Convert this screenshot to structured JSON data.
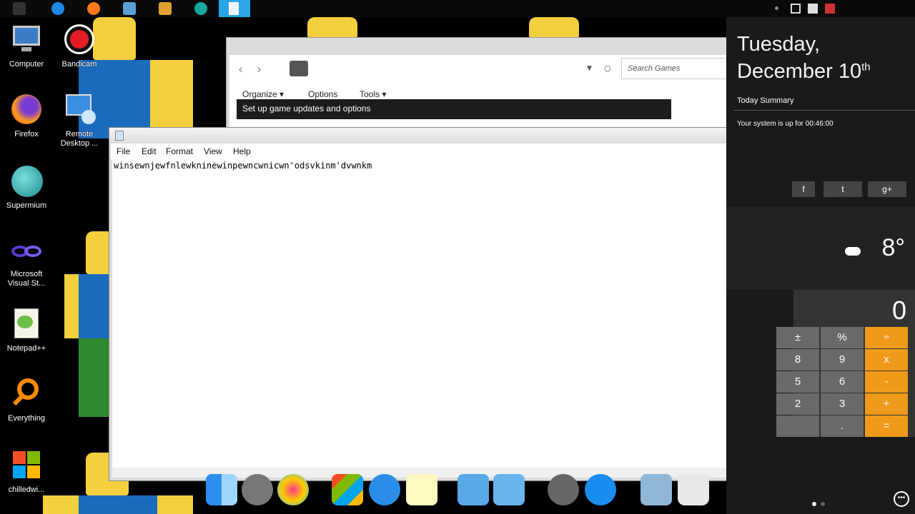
{
  "desktop": {
    "icons": [
      {
        "label": "Computer"
      },
      {
        "label": "Bandicam"
      },
      {
        "label": "Firefox"
      },
      {
        "label": "Remote Desktop ..."
      },
      {
        "label": "Supermium"
      },
      {
        "label": "Microsoft Visual St..."
      },
      {
        "label": "Notepad++"
      },
      {
        "label": "Everything"
      },
      {
        "label": "chilledwi..."
      }
    ]
  },
  "games_window": {
    "search_placeholder": "Search Games",
    "menu": [
      "Organize",
      "Options",
      "Tools"
    ],
    "banner": "Set up game updates and options"
  },
  "notepad": {
    "menu": [
      "File",
      "Edit",
      "Format",
      "View",
      "Help"
    ],
    "text": "winsewnjewfnlewkninewinpewncwnicwn'odsvkinm'dvwnkm"
  },
  "panel": {
    "day": "Tuesday,",
    "date": "December 10",
    "date_suffix": "th",
    "summary": "Today Summary",
    "uptime": "Your system is up for 00:46:00",
    "social": [
      "f",
      "t",
      "g+"
    ],
    "temperature": "8°",
    "calc_display": "0",
    "calc_keys": [
      [
        "±",
        "%",
        "÷"
      ],
      [
        "8",
        "9",
        "x"
      ],
      [
        "5",
        "6",
        "-"
      ],
      [
        "2",
        "3",
        "+"
      ],
      [
        "",
        ".",
        "="
      ]
    ]
  },
  "colors": {
    "taskbar_active": "#2aa5e8",
    "calc_operator": "#ef9a1a",
    "noob_head": "#f4d03f",
    "noob_body": "#1a6bbd"
  }
}
